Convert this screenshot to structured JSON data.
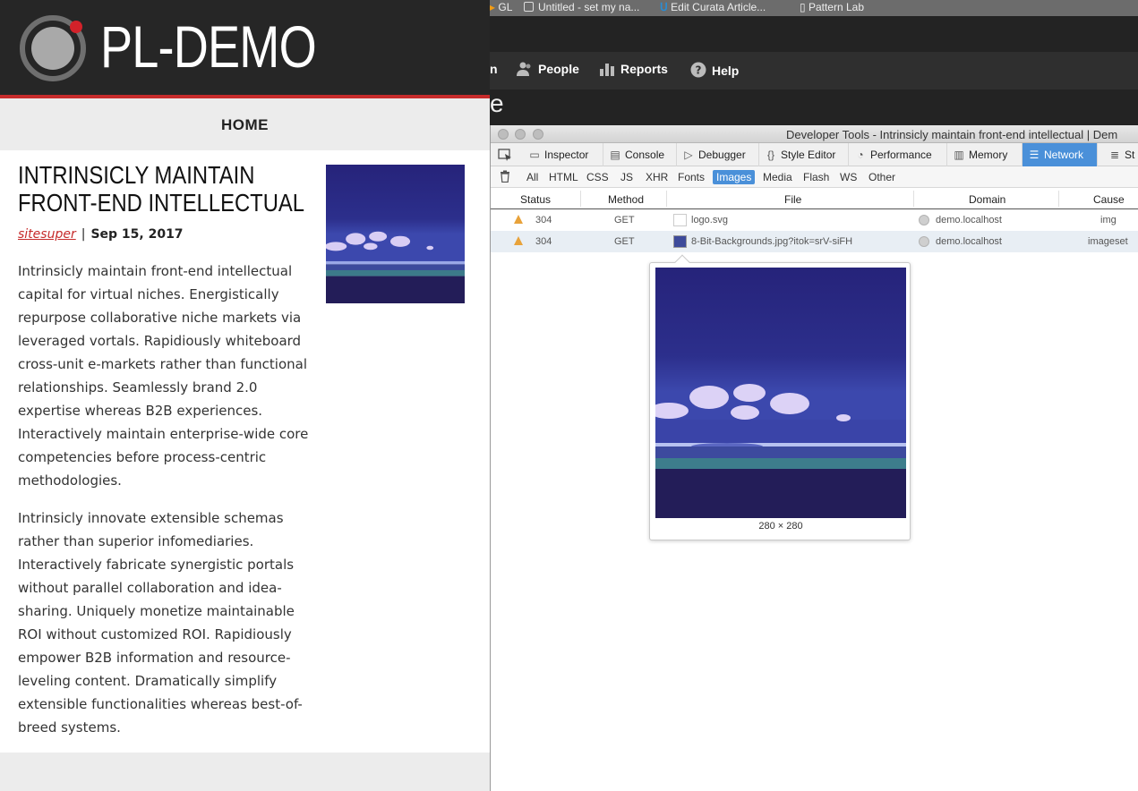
{
  "site": {
    "name": "PL-DEMO",
    "nav_home": "HOME",
    "article": {
      "title": "INTRINSICLY MAINTAIN FRONT-END INTELLECTUAL",
      "author": "sitesuper",
      "separator": "|",
      "date": "Sep 15, 2017",
      "paragraph1": "Intrinsicly maintain front-end intellectual capital for virtual niches. Energistically repurpose collaborative niche markets via leveraged vortals. Rapidiously whiteboard cross-unit e-markets rather than functional relationships. Seamlessly brand 2.0 expertise whereas B2B experiences. Interactively maintain enterprise-wide core competencies before process-centric methodologies.",
      "paragraph2": "Intrinsicly innovate extensible schemas rather than superior infomediaries. Interactively fabricate synergistic portals without parallel collaboration and idea-sharing. Uniquely monetize maintainable ROI without customized ROI. Rapidiously empower B2B information and resource-leveling content. Dramatically simplify extensible functionalities whereas best-of-breed systems."
    }
  },
  "browser": {
    "bookmarks": [
      "GL",
      "Untitled - set my na...",
      "Edit Curata Article...",
      "Pattern Lab"
    ],
    "menu": {
      "partial": "n",
      "people": "People",
      "reports": "Reports",
      "help": "Help"
    },
    "page_tail": "e"
  },
  "devtools": {
    "title": "Developer Tools - Intrinsicly maintain front-end intellectual | Dem",
    "tabs": {
      "inspector": "Inspector",
      "console": "Console",
      "debugger": "Debugger",
      "style_editor": "Style Editor",
      "performance": "Performance",
      "memory": "Memory",
      "network": "Network",
      "storage": "St"
    },
    "filters": {
      "all": "All",
      "html": "HTML",
      "css": "CSS",
      "js": "JS",
      "xhr": "XHR",
      "fonts": "Fonts",
      "images": "Images",
      "media": "Media",
      "flash": "Flash",
      "ws": "WS",
      "other": "Other"
    },
    "columns": {
      "status": "Status",
      "method": "Method",
      "file": "File",
      "domain": "Domain",
      "cause": "Cause"
    },
    "rows": [
      {
        "status": "304",
        "method": "GET",
        "file": "logo.svg",
        "domain": "demo.localhost",
        "cause": "img"
      },
      {
        "status": "304",
        "method": "GET",
        "file": "8-Bit-Backgrounds.jpg?itok=srV-siFH",
        "domain": "demo.localhost",
        "cause": "imageset"
      }
    ],
    "preview_dimensions": "280 × 280"
  },
  "colors": {
    "accent_red": "#c62b2b",
    "devtools_blue": "#4a90d9",
    "warning_orange": "#e8a23a"
  }
}
